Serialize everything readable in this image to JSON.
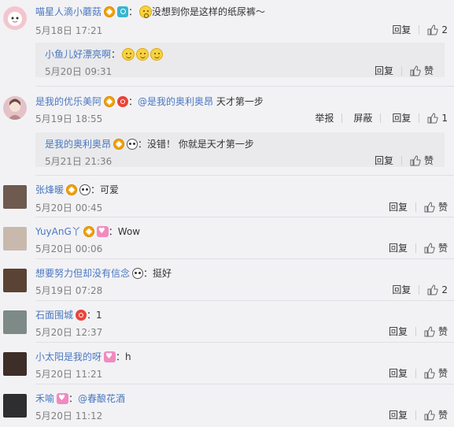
{
  "actions": {
    "reply": "回复",
    "report": "举报",
    "block": "屏蔽",
    "like": "赞"
  },
  "comments": [
    {
      "name": "喵星人滴小蘑菇",
      "text": "没想到你是这样的纸尿裤～",
      "time": "5月18日 17:21",
      "likes": "2",
      "avatar_color": "#f3c6cf",
      "reply": {
        "name": "小鱼儿好漂亮啊",
        "text": "",
        "time": "5月20日 09:31"
      }
    },
    {
      "name": "是我的优乐美阿",
      "mention": "@是我的奥利奥昂",
      "text": "天才第一步",
      "time": "5月19日 18:55",
      "likes": "1",
      "avatar_color": "#e4c2c8",
      "reply": {
        "name": "是我的奥利奥昂",
        "text": "没错！ 你就是天才第一步",
        "time": "5月21日 21:36"
      }
    },
    {
      "name": "张烽暖",
      "text": "可爱",
      "time": "5月20日 00:45",
      "avatar_color": "#6e5a4e"
    },
    {
      "name": "YuyAnG丫",
      "text": "Wow",
      "time": "5月20日 00:06",
      "avatar_color": "#c9b9ad"
    },
    {
      "name": "想要努力但却没有信念",
      "text": "挺好",
      "time": "5月19日 07:28",
      "likes": "2",
      "avatar_color": "#5a4334"
    },
    {
      "name": "石面围城",
      "text": "1",
      "time": "5月20日 12:37",
      "avatar_color": "#7d8a86"
    },
    {
      "name": "小太阳是我的呀",
      "text": "h",
      "time": "5月20日 11:21",
      "avatar_color": "#3d2e28"
    },
    {
      "name": "禾喻",
      "mention": "@春酿花酒",
      "text": "",
      "time": "5月20日 11:12",
      "avatar_color": "#2e2e30"
    }
  ]
}
